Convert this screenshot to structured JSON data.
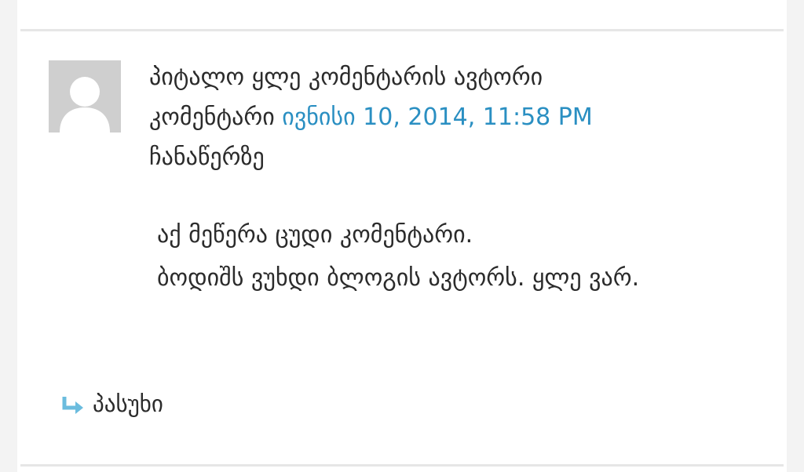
{
  "comment": {
    "author_line": "პიტალო ყლე კომენტარის ავტორი",
    "comment_word": "კომენტარი",
    "date_link": "ივნისი 10, 2014, 11:58 PM",
    "post_word": "ჩანაწერზე",
    "body_lines": [
      "აქ მეწერა ცუდი კომენტარი.",
      "ბოდიშს ვუხდი ბლოგის ავტორს. ყლე ვარ."
    ],
    "reply_label": "პასუხი"
  },
  "colors": {
    "link": "#2a8fc2",
    "reply_arrow": "#6bbcde",
    "avatar_bg": "#cfcfcf"
  },
  "icons": {
    "avatar": "default-avatar-icon",
    "reply": "reply-arrow-icon"
  }
}
